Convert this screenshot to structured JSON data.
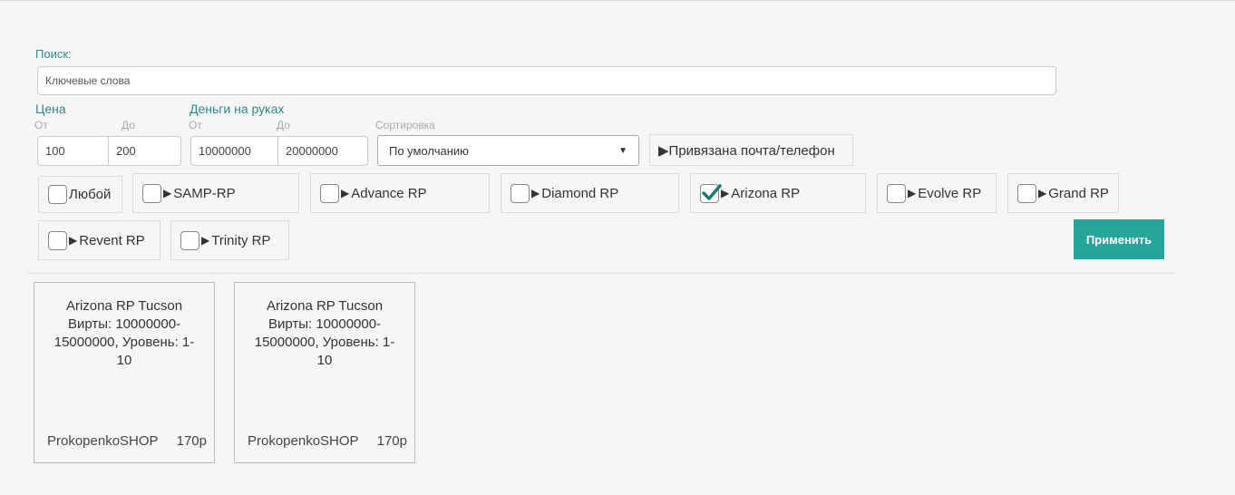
{
  "search": {
    "label": "Поиск:",
    "placeholder": "Ключевые слова"
  },
  "price": {
    "label": "Цена",
    "from_label": "От",
    "to_label": "До",
    "from_value": "100",
    "to_value": "200"
  },
  "money": {
    "label": "Деньги на руках",
    "from_label": "От",
    "to_label": "До",
    "from_value": "10000000",
    "to_value": "20000000"
  },
  "sort": {
    "label": "Сортировка",
    "selected": "По умолчанию"
  },
  "bound_button": {
    "label": "▶Привязана почта/телефон"
  },
  "servers": [
    {
      "label": "Любой",
      "checked": false,
      "arrow": ""
    },
    {
      "label": "SAMP-RP",
      "checked": false,
      "arrow": "▶"
    },
    {
      "label": "Advance RP",
      "checked": false,
      "arrow": "▶"
    },
    {
      "label": "Diamond RP",
      "checked": false,
      "arrow": "▶"
    },
    {
      "label": "Arizona RP",
      "checked": true,
      "arrow": "▶"
    },
    {
      "label": "Evolve RP",
      "checked": false,
      "arrow": "▶"
    },
    {
      "label": "Grand RP",
      "checked": false,
      "arrow": "▶"
    },
    {
      "label": "Revent RP",
      "checked": false,
      "arrow": "▶"
    },
    {
      "label": "Trinity RP",
      "checked": false,
      "arrow": "▶"
    }
  ],
  "apply_button": {
    "label": "Применить"
  },
  "accent_color": "#26a69a",
  "check_color": "#1e7b73",
  "products": [
    {
      "title": "Arizona RP Tucson Вирты: 10000000-15000000, Уровень: 1-10",
      "shop": "ProkopenkoSHOP",
      "price": "170р"
    },
    {
      "title": "Arizona RP Tucson Вирты: 10000000-15000000, Уровень: 1-10",
      "shop": "ProkopenkoSHOP",
      "price": "170р"
    }
  ]
}
